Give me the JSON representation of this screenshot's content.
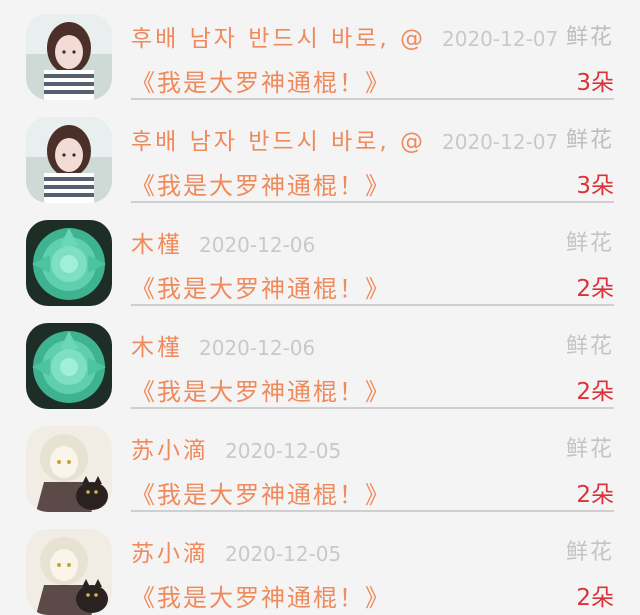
{
  "rows": [
    {
      "avatar": "girl-striped-shirt-avatar",
      "name": "후배 남자 반드시 바로, @",
      "date": "2020-12-07",
      "gift_type": "鲜花",
      "work_title": "《我是大罗神通棍！》",
      "count": "3朵"
    },
    {
      "avatar": "girl-striped-shirt-avatar",
      "name": "후배 남자 반드시 바로, @",
      "date": "2020-12-07",
      "gift_type": "鲜花",
      "work_title": "《我是大罗神通棍！》",
      "count": "3朵"
    },
    {
      "avatar": "green-flower-avatar",
      "name": "木槿",
      "date": "2020-12-06",
      "gift_type": "鲜花",
      "work_title": "《我是大罗神通棍！》",
      "count": "2朵"
    },
    {
      "avatar": "green-flower-avatar",
      "name": "木槿",
      "date": "2020-12-06",
      "gift_type": "鲜花",
      "work_title": "《我是大罗神通棍！》",
      "count": "2朵"
    },
    {
      "avatar": "anime-girl-cat-avatar",
      "name": "苏小滴",
      "date": "2020-12-05",
      "gift_type": "鲜花",
      "work_title": "《我是大罗神通棍！》",
      "count": "2朵"
    },
    {
      "avatar": "anime-girl-cat-avatar",
      "name": "苏小滴",
      "date": "2020-12-05",
      "gift_type": "鲜花",
      "work_title": "《我是大罗神通棍！》",
      "count": "2朵"
    }
  ],
  "colors": {
    "name": "#ef8a5c",
    "date": "#c9c9c9",
    "gift_type": "#c4c4c4",
    "count": "#d9323a",
    "background": "#f4f4f4"
  }
}
